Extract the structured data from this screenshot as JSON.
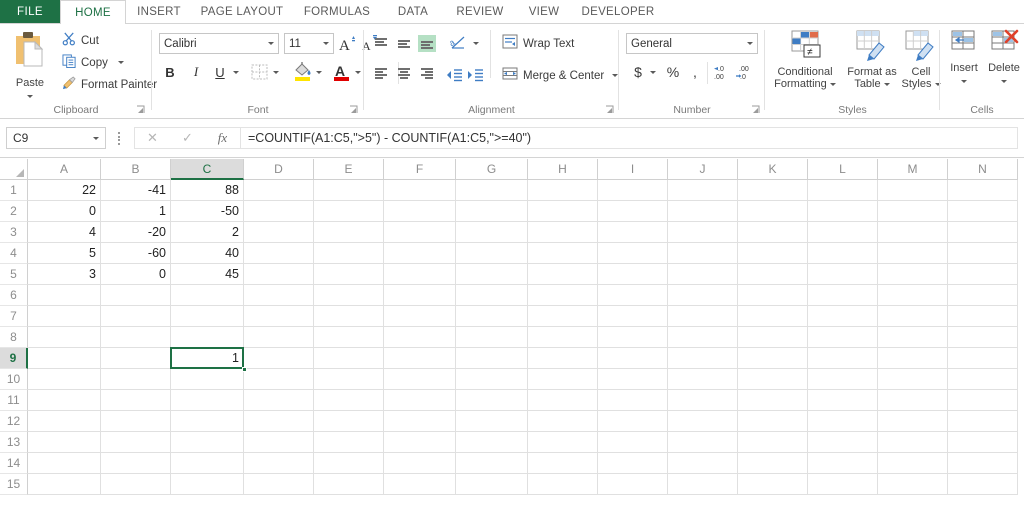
{
  "app": {
    "title": "Excel"
  },
  "tabs": [
    {
      "label": "FILE",
      "active": false,
      "file": true
    },
    {
      "label": "HOME",
      "active": true
    },
    {
      "label": "INSERT",
      "active": false
    },
    {
      "label": "PAGE LAYOUT",
      "active": false
    },
    {
      "label": "FORMULAS",
      "active": false
    },
    {
      "label": "DATA",
      "active": false
    },
    {
      "label": "REVIEW",
      "active": false
    },
    {
      "label": "VIEW",
      "active": false
    },
    {
      "label": "DEVELOPER",
      "active": false
    }
  ],
  "ribbon": {
    "clipboard": {
      "label": "Clipboard",
      "paste": "Paste",
      "cut": "Cut",
      "copy": "Copy",
      "format_painter": "Format Painter"
    },
    "font": {
      "label": "Font",
      "font_name": "Calibri",
      "font_size": "11",
      "grow_font": "A",
      "shrink_font": "A",
      "bold": "B",
      "italic": "I",
      "underline": "U",
      "font_color_letter": "A"
    },
    "alignment": {
      "label": "Alignment",
      "wrap_text": "Wrap Text",
      "merge_center": "Merge & Center"
    },
    "number": {
      "label": "Number",
      "format": "General",
      "accounting": "$",
      "percent": "%",
      "comma": ",",
      "increase_decimal": ".00",
      "decrease_decimal": ".00"
    },
    "styles": {
      "label": "Styles",
      "conditional_formatting": "Conditional\nFormatting",
      "conditional_formatting_l1": "Conditional",
      "conditional_formatting_l2": "Formatting",
      "format_as_table_l1": "Format as",
      "format_as_table_l2": "Table",
      "cell_styles_l1": "Cell",
      "cell_styles_l2": "Styles"
    },
    "cells": {
      "label": "Cells",
      "insert": "Insert",
      "delete": "Delete"
    }
  },
  "formula_bar": {
    "name_box": "C9",
    "cancel_icon": "✕",
    "enter_icon": "✓",
    "function_icon": "fx",
    "formula": "=COUNTIF(A1:C5,\">5\") - COUNTIF(A1:C5,\">=40\")",
    "annotation": {
      "type": "arrow",
      "direction": "left",
      "color": "#e00000"
    }
  },
  "sheet": {
    "columns": [
      "A",
      "B",
      "C",
      "D",
      "E",
      "F",
      "G",
      "H",
      "I",
      "J",
      "K",
      "L",
      "M",
      "N"
    ],
    "selected_column": "C",
    "rows": [
      "1",
      "2",
      "3",
      "4",
      "5",
      "6",
      "7",
      "8",
      "9",
      "10",
      "11",
      "12",
      "13",
      "14",
      "15"
    ],
    "selected_row": "9",
    "selected_cell": "C9",
    "selected_cell_value": "1",
    "data": [
      {
        "row": "1",
        "A": "22",
        "B": "-41",
        "C": "88"
      },
      {
        "row": "2",
        "A": "0",
        "B": "1",
        "C": "-50"
      },
      {
        "row": "3",
        "A": "4",
        "B": "-20",
        "C": "2"
      },
      {
        "row": "4",
        "A": "5",
        "B": "-60",
        "C": "40"
      },
      {
        "row": "5",
        "A": "3",
        "B": "0",
        "C": "45"
      }
    ]
  },
  "colors": {
    "accent": "#1e7145",
    "file_tab": "#1e7145",
    "annotation_arrow": "#e00000",
    "grid_line": "#e0e0e0",
    "header_selected": "#dcdcdc"
  }
}
